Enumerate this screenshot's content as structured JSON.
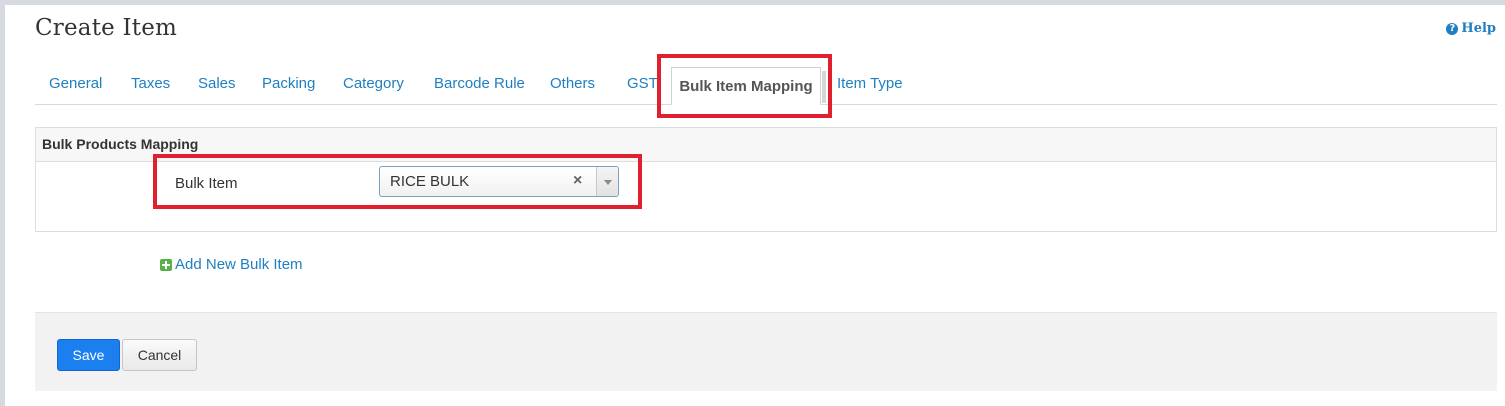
{
  "page": {
    "title": "Create Item",
    "help_label": "Help",
    "help_icon": "question-circle-icon"
  },
  "tabs": [
    {
      "label": "General",
      "active": false
    },
    {
      "label": "Taxes",
      "active": false
    },
    {
      "label": "Sales",
      "active": false
    },
    {
      "label": "Packing",
      "active": false
    },
    {
      "label": "Category",
      "active": false
    },
    {
      "label": "Barcode Rule",
      "active": false
    },
    {
      "label": "Others",
      "active": false
    },
    {
      "label": "GST",
      "active": false
    },
    {
      "label": "Bulk Item Mapping",
      "active": true
    },
    {
      "label": "Item Type",
      "active": false
    }
  ],
  "panel": {
    "header": "Bulk Products Mapping",
    "field_label": "Bulk Item",
    "selected_value": "RICE BULK",
    "clear_glyph": "×"
  },
  "add_link": {
    "label": "Add New Bulk Item",
    "icon": "plus-square-icon"
  },
  "footer": {
    "save_label": "Save",
    "cancel_label": "Cancel"
  },
  "colors": {
    "link": "#1f7fc1",
    "primary_button": "#1b7ff0",
    "highlight": "#e0202e",
    "add_icon": "#58b047"
  }
}
